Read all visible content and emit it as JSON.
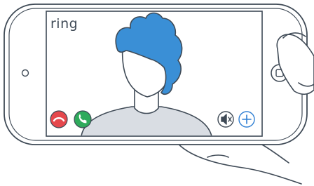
{
  "brand": {
    "logo_text": "ring"
  },
  "colors": {
    "outline": "#3f4a56",
    "phone_body": "#ffffff",
    "screen_bg": "#ffffff",
    "hair": "#3a8fd6",
    "shirt": "#d9dde3",
    "decline": "#e5484d",
    "accept": "#2faa5c",
    "accent": "#2f7fd3"
  },
  "icons": {
    "decline": "phone-hangup-icon",
    "accept": "phone-answer-icon",
    "mute": "speaker-mute-icon",
    "add": "plus-icon",
    "home": "home-button-icon"
  }
}
